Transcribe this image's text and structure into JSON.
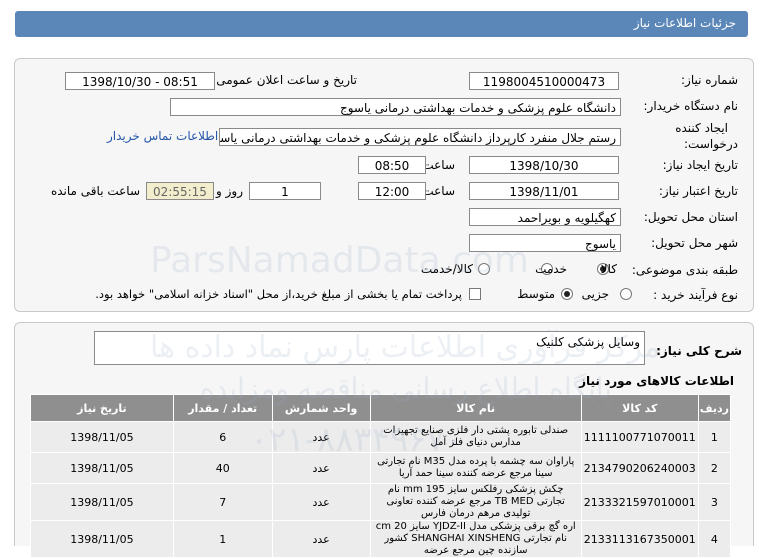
{
  "header": {
    "title": "جزئیات اطلاعات نیاز"
  },
  "form": {
    "need_number_label": "شماره نیاز:",
    "need_number": "1198004510000473",
    "announce_label": "تاریخ و ساعت اعلان عمومی:",
    "announce_value": "1398/10/30 - 08:51",
    "buyer_label": "نام دستگاه خریدار:",
    "buyer_value": "دانشگاه علوم پزشکی و خدمات بهداشتی درمانی یاسوج",
    "creator_label_1": "ایجاد کننده",
    "creator_label_2": "درخواست:",
    "creator_value": "رستم جلال منفرد کارپرداز دانشگاه علوم پزشکی و خدمات بهداشتی درمانی یاسوج",
    "contact_link": "اطلاعات تماس خریدار",
    "create_date_label": "تاریخ ایجاد نیاز:",
    "create_date": "1398/10/30",
    "hour_label": "ساعت",
    "create_time": "08:50",
    "validity_label": "تاریخ اعتبار نیاز:",
    "validity_date": "1398/11/01",
    "validity_time": "12:00",
    "days_value": "1",
    "days_label": "روز و",
    "remaining_time": "02:55:15",
    "remaining_label": "ساعت باقی مانده",
    "province_label": "استان محل تحویل:",
    "province_value": "کهگیلویه و بویراحمد",
    "city_label": "شهر محل تحویل:",
    "city_value": "یاسوج",
    "category_label": "طبقه بندی موضوعی:",
    "category_options": [
      "کالا",
      "خدمت",
      "کالا/خدمت"
    ],
    "category_selected": "کالا",
    "process_label": "نوع فرآیند خرید :",
    "process_options": [
      "جزیی",
      "متوسط"
    ],
    "process_selected": "متوسط",
    "payment_note": "پرداخت تمام یا بخشی از مبلغ خرید،از محل \"اسناد خزانه اسلامی\" خواهد بود."
  },
  "summary": {
    "label": "شرح کلی نیاز:",
    "value": "وسایل پزشکی کلنیک"
  },
  "goods": {
    "title": "اطلاعات کالاهای مورد نیاز",
    "columns": [
      "ردیف",
      "کد کالا",
      "نام کالا",
      "واحد شمارش",
      "تعداد / مقدار",
      "تاریخ نیاز"
    ],
    "rows": [
      {
        "n": "1",
        "code": "1111100771070011",
        "name": "صندلی تابوره پشتی دار فلزی صنایع تجهیزات مدارس دنیای فلز آمل",
        "unit": "عدد",
        "qty": "6",
        "date": "1398/11/05"
      },
      {
        "n": "2",
        "code": "2134790206240003",
        "name": "پاراوان سه چشمه با پرده مدل M35 نام تجارتی سینا مرجع عرضه کننده سینا حمد آریا",
        "unit": "عدد",
        "qty": "40",
        "date": "1398/11/05"
      },
      {
        "n": "3",
        "code": "2133321597010001",
        "name": "چکش پزشکی رفلکس سایز 195 mm نام تجارتی TB MED مرجع عرضه کننده تعاونی تولیدی مرهم درمان فارس",
        "unit": "عدد",
        "qty": "7",
        "date": "1398/11/05"
      },
      {
        "n": "4",
        "code": "2133113167350001",
        "name": "اره گچ برقی پزشکی مدل YJDZ-II سایز 20 cm نام تجارتی SHANGHAI XINSHENG کشور سازنده چین مرجع عرضه",
        "unit": "عدد",
        "qty": "1",
        "date": "1398/11/05"
      }
    ]
  },
  "watermark": {
    "line1": "مرکز فرآوری اطلاعات پارس نماد داده ها",
    "line2": "پایگاه اطلاع رسانی مناقصه ومزایده",
    "line3": "۰۲۱-۸۸۳۴۹۶۷۰",
    "line4": "ParsNamadData.com"
  }
}
